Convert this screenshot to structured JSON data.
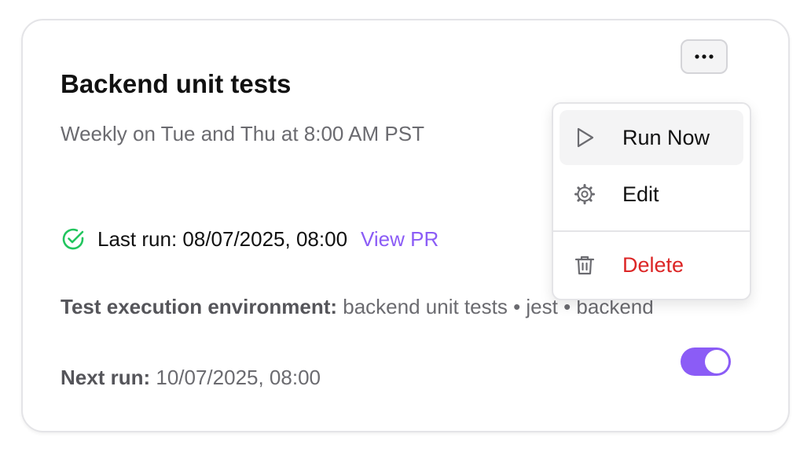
{
  "card": {
    "title": "Backend unit tests",
    "schedule": "Weekly on Tue and Thu at 8:00 AM PST",
    "last_run_text": "Last run: 08/07/2025, 08:00",
    "view_pr_label": "View PR",
    "env_label": "Test execution environment:",
    "env_value": "backend unit tests • jest • backend",
    "next_run_label": "Next run:",
    "next_run_value": "10/07/2025, 08:00",
    "schedule_enabled": true
  },
  "menu": {
    "items": [
      {
        "label": "Run Now",
        "icon": "play-icon"
      },
      {
        "label": "Edit",
        "icon": "gear-icon"
      },
      {
        "label": "Delete",
        "icon": "trash-icon"
      }
    ]
  },
  "colors": {
    "accent": "#8b5cf6",
    "success": "#22c55e",
    "danger": "#dc2626",
    "muted_text": "#6b6b70"
  }
}
